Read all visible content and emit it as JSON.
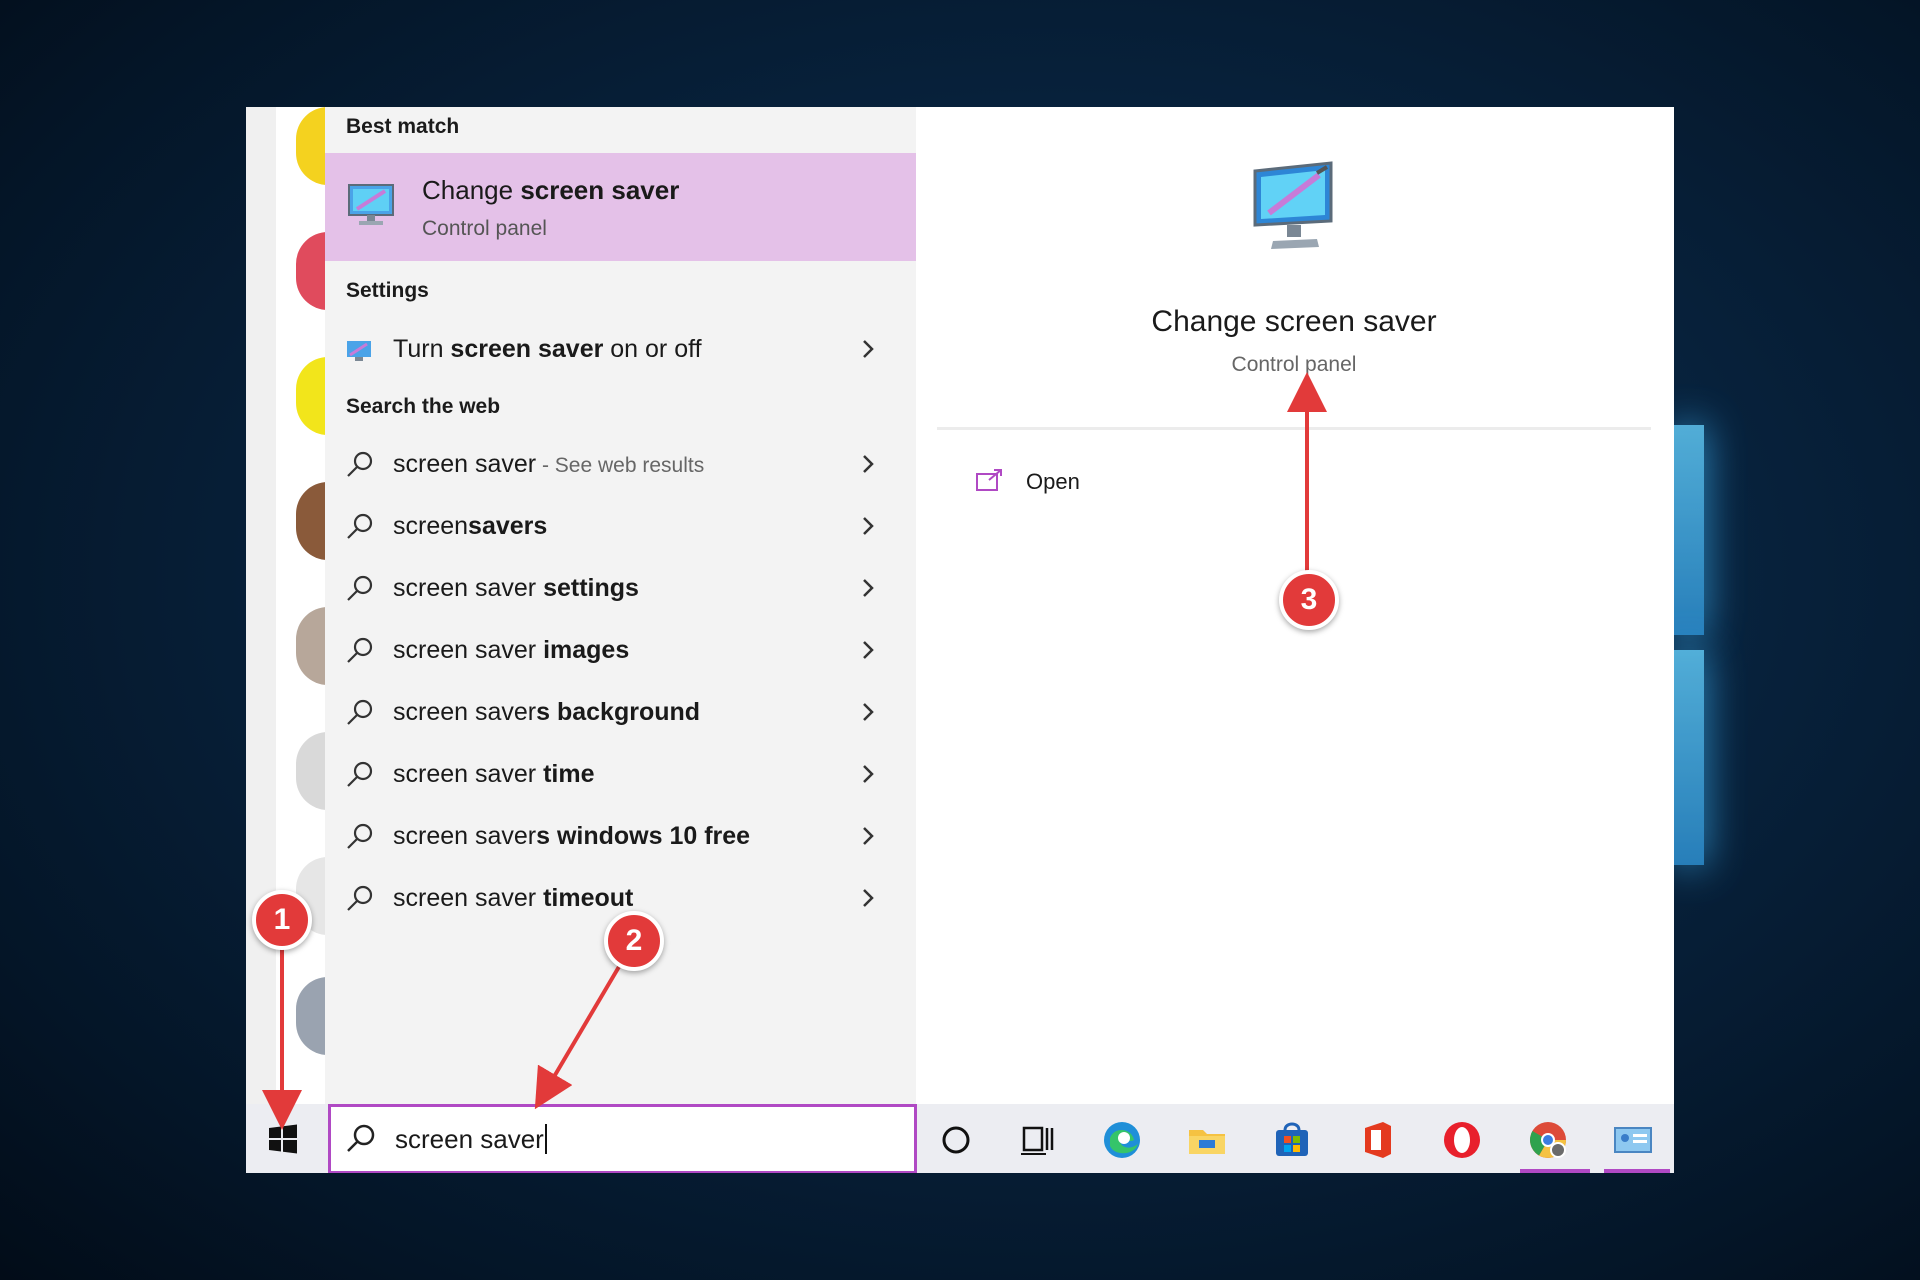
{
  "results": {
    "best_match_header": "Best match",
    "best_match": {
      "title_pre": "Change ",
      "title_bold": "screen saver",
      "subtitle": "Control panel"
    },
    "settings_header": "Settings",
    "settings_item": {
      "pre": "Turn ",
      "bold": "screen saver",
      "post": " on or off"
    },
    "web_header": "Search the web",
    "web_items": [
      {
        "pre": "screen saver",
        "bold": "",
        "hint": " - See web results"
      },
      {
        "pre": "screen",
        "bold": "savers",
        "hint": ""
      },
      {
        "pre": "screen saver ",
        "bold": "settings",
        "hint": ""
      },
      {
        "pre": "screen saver ",
        "bold": "images",
        "hint": ""
      },
      {
        "pre": "screen saver",
        "bold": "s background",
        "hint": ""
      },
      {
        "pre": "screen saver ",
        "bold": "time",
        "hint": ""
      },
      {
        "pre": "screen saver",
        "bold": "s windows 10 free",
        "hint": ""
      },
      {
        "pre": "screen saver ",
        "bold": "timeout",
        "hint": ""
      }
    ]
  },
  "detail": {
    "title": "Change screen saver",
    "subtitle": "Control panel",
    "open_label": "Open"
  },
  "search": {
    "value": "screen saver"
  },
  "taskbar": {
    "icons": [
      "cortana-icon",
      "task-view-icon",
      "edge-icon",
      "file-explorer-icon",
      "microsoft-store-icon",
      "office-icon",
      "opera-icon",
      "chrome-icon",
      "control-panel-icon"
    ]
  },
  "annotations": {
    "badge1": "1",
    "badge2": "2",
    "badge3": "3"
  },
  "colors": {
    "accent": "#b049c4",
    "highlight": "#e4c1e8",
    "badge": "#e23a3a"
  }
}
